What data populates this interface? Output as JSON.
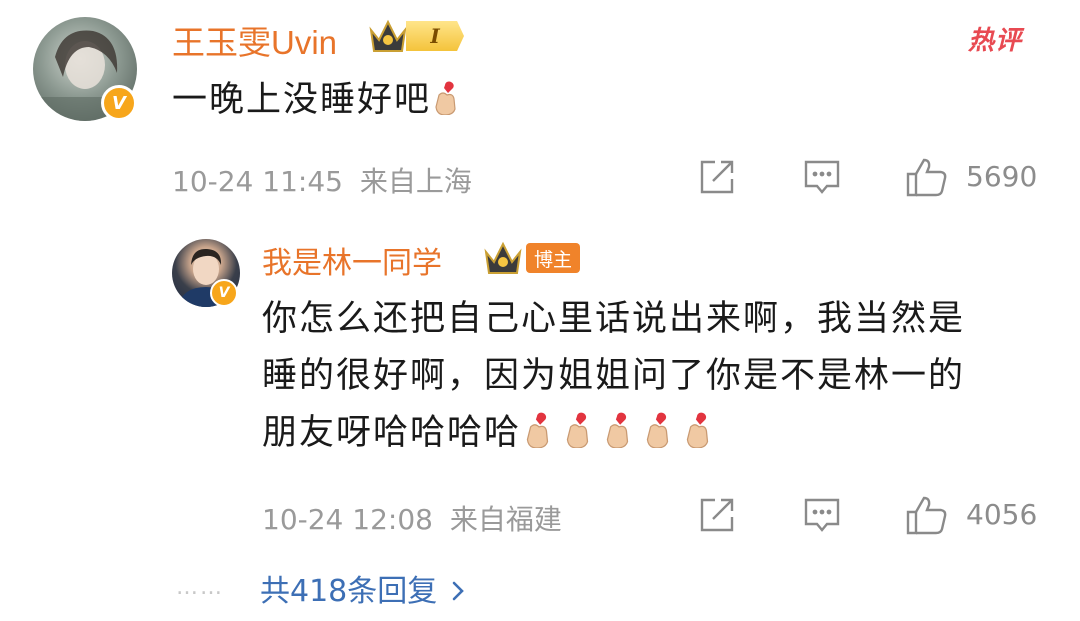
{
  "comment": {
    "username": "王玉雯Uvin",
    "level_badge": "I",
    "hot_tag": "热评",
    "text": "一晚上没睡好吧",
    "time": "10-24 11:45",
    "location": "来自上海",
    "likes": "5690",
    "icons": [
      "share-icon",
      "comment-icon",
      "like-icon"
    ]
  },
  "reply": {
    "username": "我是林一同学",
    "host_badge": "博主",
    "text_lines": [
      "你怎么还把自己心里话说出来啊，我当然是",
      "睡的很好啊，因为姐姐问了你是不是林一的",
      "朋友呀哈哈哈哈"
    ],
    "finger_heart_count": 5,
    "time": "10-24 12:08",
    "location": "来自福建",
    "likes": "4056"
  },
  "more_replies": "共418条回复",
  "colors": {
    "username": "#e8742a",
    "link": "#3d6fb5",
    "hot": "#e84a52",
    "meta": "#9a9a9a"
  }
}
